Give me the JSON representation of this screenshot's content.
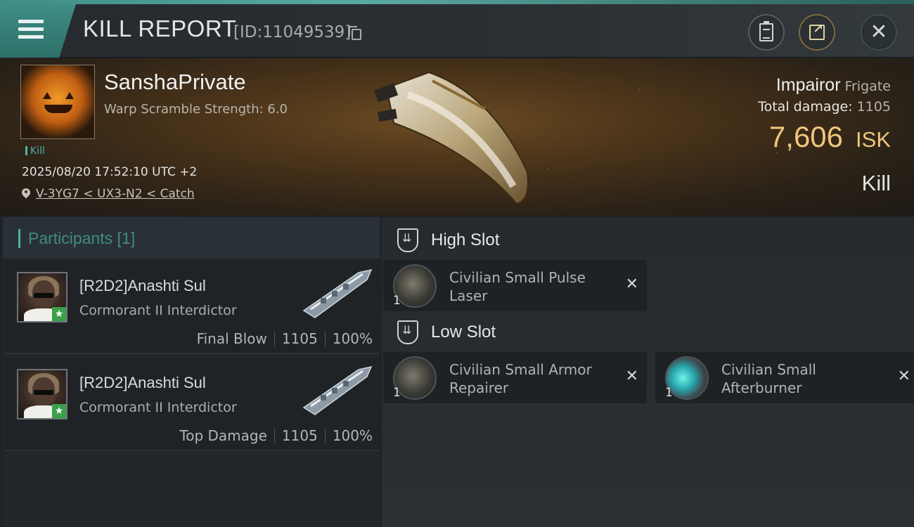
{
  "header": {
    "title": "KILL REPORT",
    "report_id": "[ID:11049539]"
  },
  "victim": {
    "name": "SanshaPrivate",
    "warp_scramble": "Warp Scramble Strength: 6.0",
    "tag": "Kill",
    "datetime": "2025/08/20 17:52:10 UTC +2",
    "location": "V-3YG7 < UX3-N2 < Catch",
    "ship_name": "Impairor",
    "ship_class": "Frigate",
    "total_damage_label": "Total damage:",
    "total_damage": "1105",
    "isk_value": "7,606",
    "isk_unit": "ISK",
    "kill_type": "Kill"
  },
  "participants": {
    "title": "Participants [1]",
    "rows": [
      {
        "name": "[R2D2]Anashti Sul",
        "ship": "Cormorant II Interdictor",
        "role": "Final Blow",
        "damage": "1105",
        "percent": "100%"
      },
      {
        "name": "[R2D2]Anashti Sul",
        "ship": "Cormorant II Interdictor",
        "role": "Top Damage",
        "damage": "1105",
        "percent": "100%"
      }
    ]
  },
  "fittings": {
    "high_slot_label": "High Slot",
    "low_slot_label": "Low Slot",
    "high": [
      {
        "qty": "1",
        "name": "Civilian Small Pulse Laser"
      }
    ],
    "low": [
      {
        "qty": "1",
        "name": "Civilian Small Armor Repairer"
      },
      {
        "qty": "1",
        "name": "Civilian Small Afterburner"
      }
    ]
  },
  "colors": {
    "accent": "#4fb2a6",
    "isk": "#f0c67a"
  }
}
